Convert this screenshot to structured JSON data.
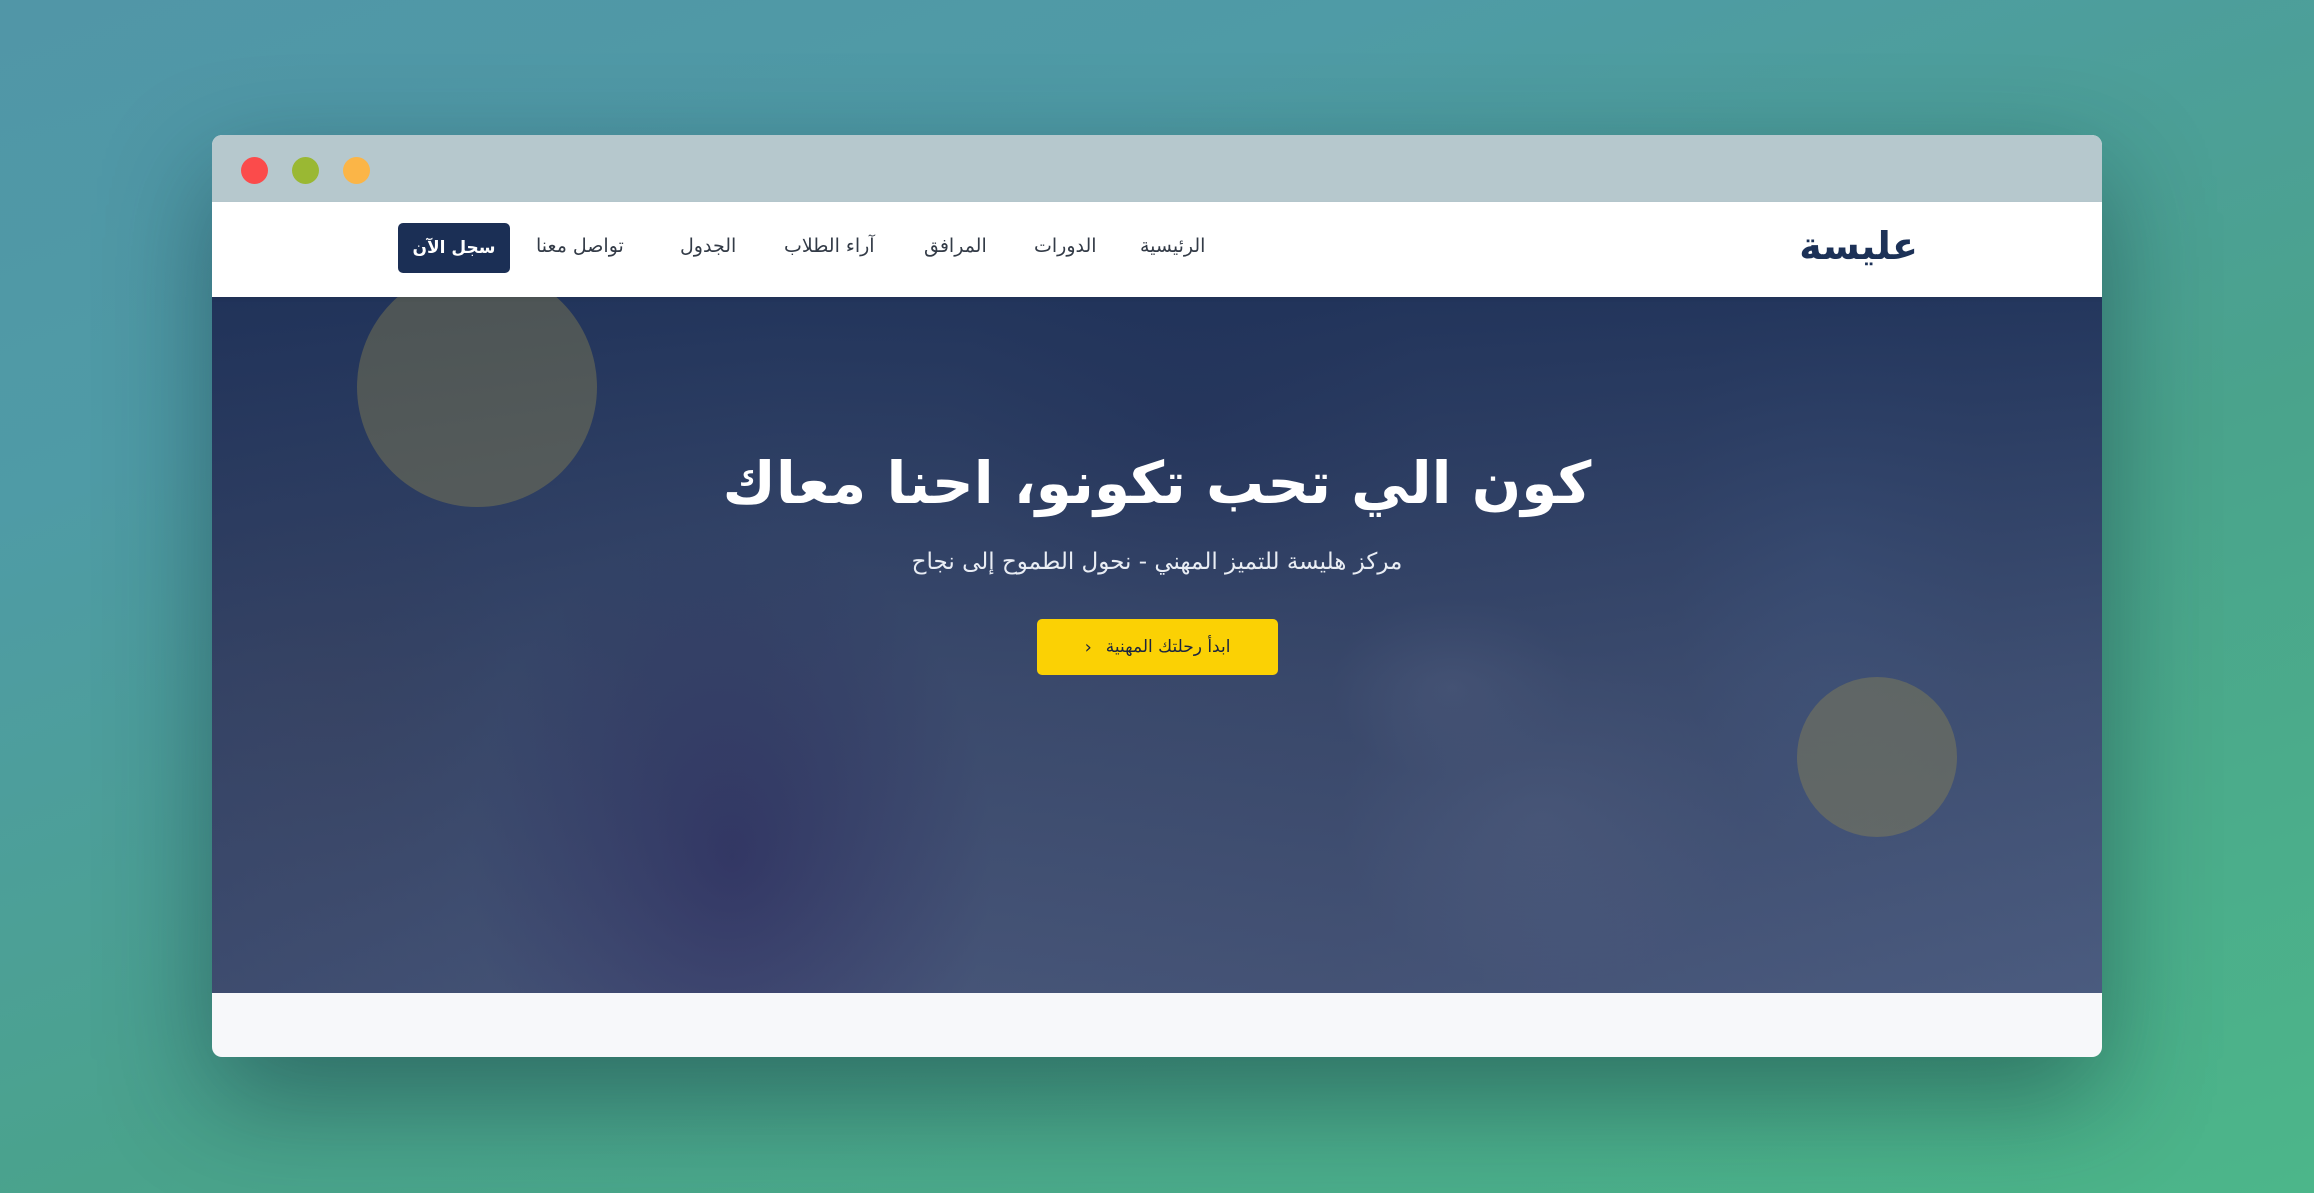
{
  "nav": {
    "logo": "عليسة",
    "links": [
      "الرئيسية",
      "الدورات",
      "المرافق",
      "آراء الطلاب",
      "الجدول",
      "تواصل معنا"
    ],
    "register": "سجل الآن"
  },
  "hero": {
    "headline": "كون الي تحب تكونو، احنا معاك",
    "subtitle": "مركز هليسة للتميز المهني - نحول الطموح إلى نجاح",
    "cta": "ابدأ رحلتك المهنية",
    "cta_icon": "chevron-left-icon"
  },
  "colors": {
    "navy": "#1b2f55",
    "accent_yellow": "#fbd104",
    "window_red": "#fb4b4b",
    "window_green": "#9ab833",
    "window_yellow": "#fbb547"
  }
}
